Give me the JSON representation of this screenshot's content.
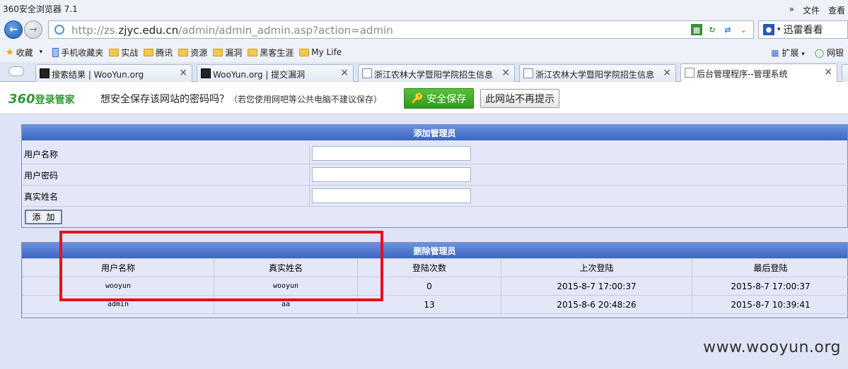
{
  "browser": {
    "title": "360安全浏览器 7.1",
    "menu": [
      "»",
      "文件",
      "查看"
    ],
    "url_prefix": "http://zs.",
    "url_domain": "zjyc.edu.cn",
    "url_path": "/admin/admin_admin.asp?action=admin",
    "toolbar_label": "迅雷看看"
  },
  "bookmarks": {
    "items": [
      "收藏",
      "手机收藏夹",
      "实战",
      "腾讯",
      "资源",
      "漏洞",
      "黑客生涯",
      "My Life"
    ],
    "right": [
      "扩展",
      "网银"
    ]
  },
  "tabs": [
    {
      "label": "搜索结果 | WooYun.org"
    },
    {
      "label": "WooYun.org | 提交漏洞"
    },
    {
      "label": "浙江农林大学暨阳学院招生信息"
    },
    {
      "label": "浙江农林大学暨阳学院招生信息"
    },
    {
      "label": "后台管理程序--管理系统"
    }
  ],
  "password_bar": {
    "logo_num": "360",
    "logo_text": "登录管家",
    "question": "想安全保存该网站的密码吗？",
    "hint": "（若您使用网吧等公共电脑不建议保存）",
    "save_label": "安全保存",
    "nomore_label": "此网站不再提示"
  },
  "add_admin": {
    "title": "添加管理员",
    "fields": [
      {
        "label": "用户名称",
        "value": ""
      },
      {
        "label": "用户密码",
        "value": ""
      },
      {
        "label": "真实姓名",
        "value": ""
      }
    ],
    "add_label": "添加"
  },
  "delete_admin": {
    "title": "删除管理员",
    "columns": [
      "用户名称",
      "真实姓名",
      "登陆次数",
      "上次登陆",
      "最后登陆"
    ],
    "rows": [
      [
        "wooyun",
        "wooyun",
        "0",
        "2015-8-7 17:00:37",
        "2015-8-7 17:00:37"
      ],
      [
        "admin",
        "aa",
        "13",
        "2015-8-6 20:48:26",
        "2015-8-7 10:39:41"
      ]
    ]
  },
  "watermark": "www.wooyun.org",
  "colors": {
    "highlight_box": "#e0141a",
    "panel_header": "#3c66c4",
    "save_button": "#2e9a1a"
  }
}
